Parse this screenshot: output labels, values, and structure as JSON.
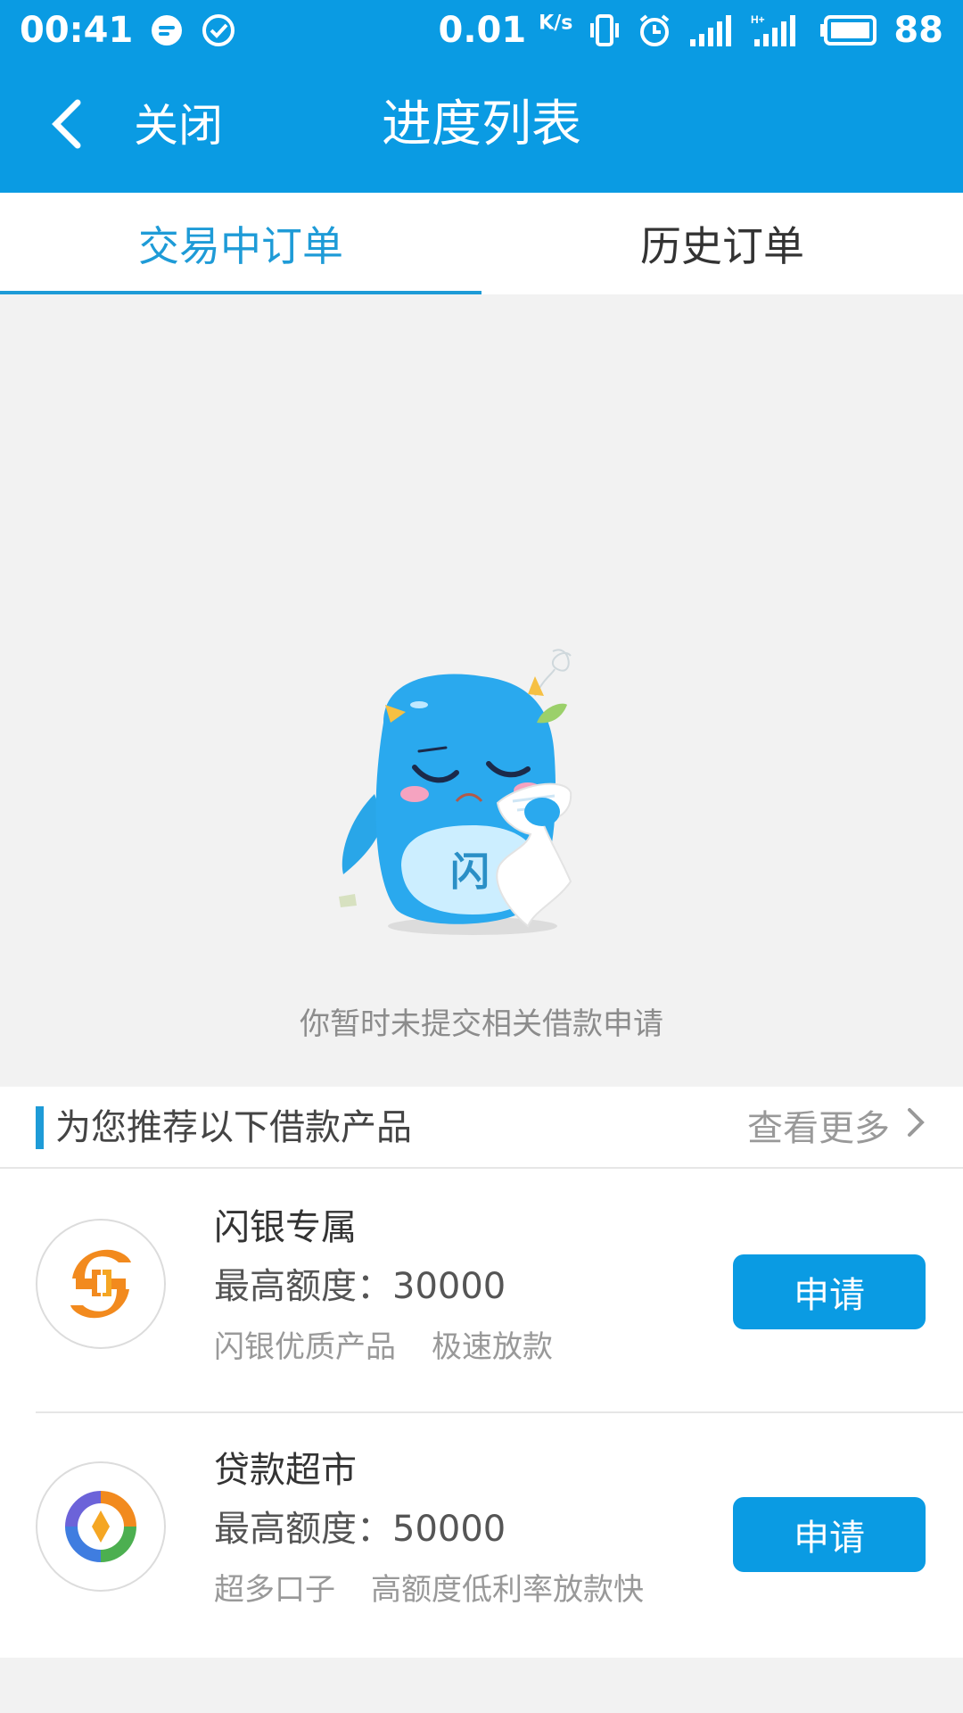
{
  "status_bar": {
    "time": "00:41",
    "speed": "0.01",
    "speed_unit": "K/s",
    "battery": "88",
    "icons": [
      "message-icon",
      "check-circle-icon",
      "vibrate-icon",
      "alarm-icon",
      "signal-icon",
      "hplus-signal-icon",
      "battery-icon"
    ]
  },
  "header": {
    "back_icon": "chevron-left-icon",
    "close_label": "关闭",
    "title": "进度列表"
  },
  "tabs": [
    {
      "label": "交易中订单",
      "active": true
    },
    {
      "label": "历史订单",
      "active": false
    }
  ],
  "empty_state": {
    "mascot_badge": "闪",
    "message": "你暂时未提交相关借款申请"
  },
  "recommend": {
    "title": "为您推荐以下借款产品",
    "more_label": "查看更多",
    "products": [
      {
        "name": "闪银专属",
        "limit": "最高额度：30000",
        "tags": [
          "闪银优质产品",
          "极速放款"
        ],
        "apply_label": "申请",
        "logo_icon": "shanyin-logo-icon"
      },
      {
        "name": "贷款超市",
        "limit": "最高额度：50000",
        "tags": [
          "超多口子",
          "高额度低利率放款快"
        ],
        "apply_label": "申请",
        "logo_icon": "loan-market-logo-icon"
      }
    ]
  },
  "colors": {
    "primary": "#0a9be3",
    "tab_active": "#1e9bd7",
    "background": "#f2f2f2"
  }
}
